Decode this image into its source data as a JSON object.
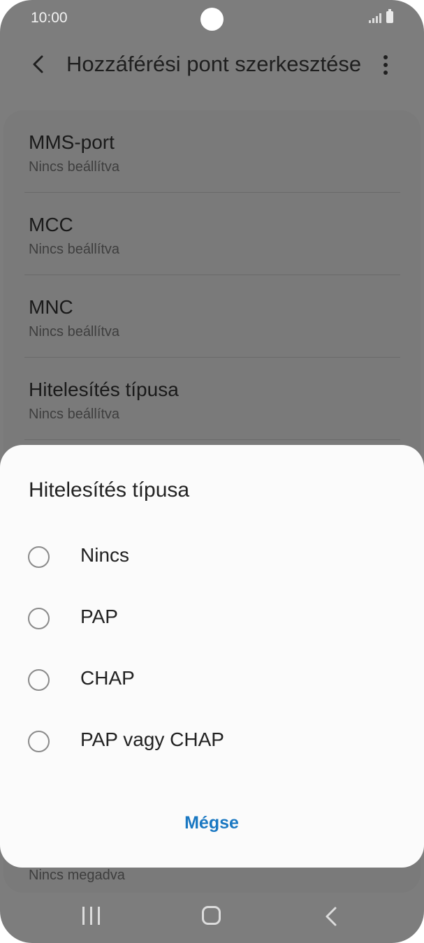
{
  "status_bar": {
    "time": "10:00"
  },
  "header": {
    "title": "Hozzáférési pont szerkesztése",
    "back_icon": "chevron-left-icon",
    "more_icon": "more-vertical-icon"
  },
  "list": {
    "items": [
      {
        "label": "MMS-port",
        "value": "Nincs beállítva"
      },
      {
        "label": "MCC",
        "value": "Nincs beállítva"
      },
      {
        "label": "MNC",
        "value": "Nincs beállítva"
      },
      {
        "label": "Hitelesítés típusa",
        "value": "Nincs beállítva"
      }
    ],
    "bottom_value": "Nincs megadva"
  },
  "dialog": {
    "title": "Hitelesítés típusa",
    "options": [
      {
        "label": "Nincs",
        "selected": false
      },
      {
        "label": "PAP",
        "selected": false
      },
      {
        "label": "CHAP",
        "selected": false
      },
      {
        "label": "PAP vagy CHAP",
        "selected": false
      }
    ],
    "cancel_label": "Mégse"
  },
  "colors": {
    "accent": "#1a78c2",
    "scrim": "#7d7d7d",
    "dialog_bg": "#fbfbfb"
  }
}
